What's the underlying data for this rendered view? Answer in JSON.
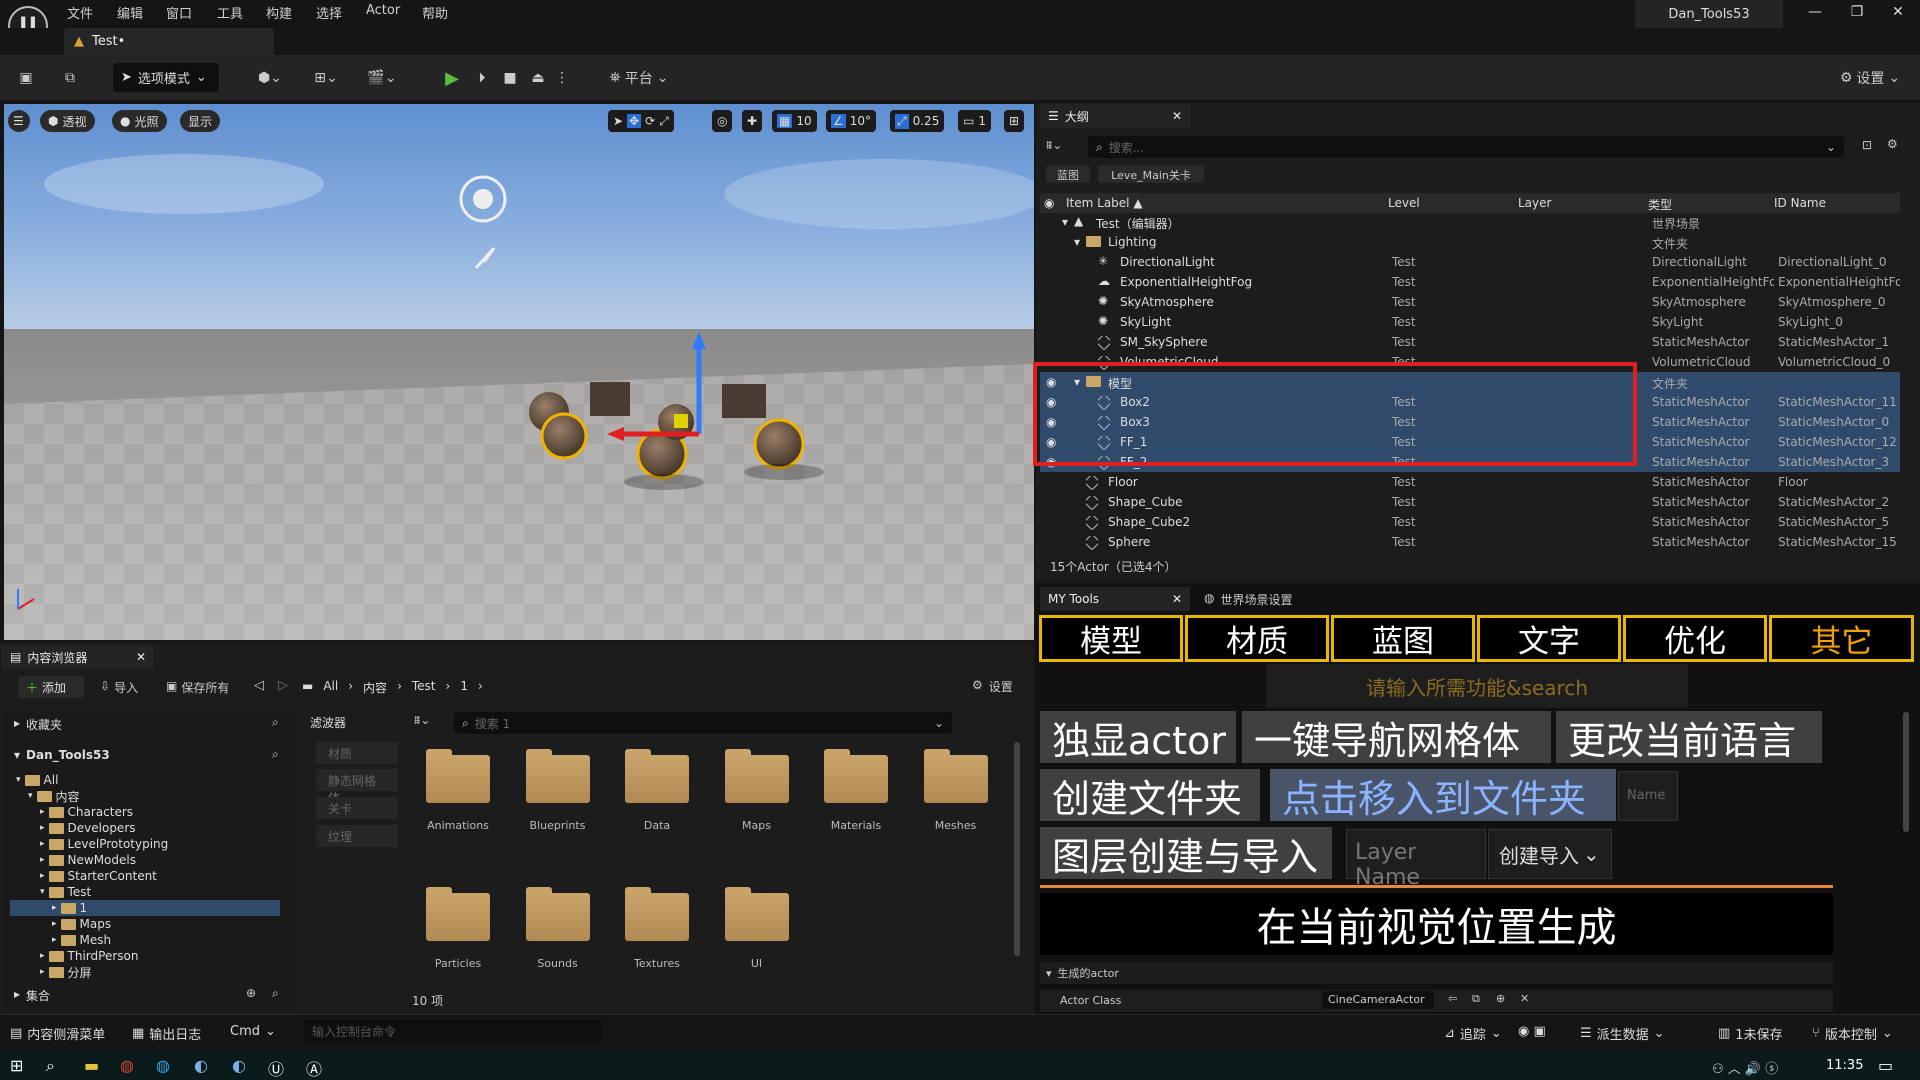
{
  "menu": [
    "文件",
    "编辑",
    "窗口",
    "工具",
    "构建",
    "选择",
    "Actor",
    "帮助"
  ],
  "project_name": "Dan_Tools53",
  "level_tab": "Test•",
  "toolbar": {
    "mode": "选项模式",
    "platform": "平台",
    "settings": "设置"
  },
  "viewport": {
    "perspective": "透视",
    "lighting": "光照",
    "show": "显示",
    "grid_snap": "10",
    "rot_snap": "10°",
    "scale_snap": "0.25",
    "camera_speed": "1"
  },
  "outliner": {
    "tab": "大纲",
    "search_placeholder": "搜索...",
    "chips": [
      "蓝图",
      "Leve_Main关卡"
    ],
    "columns": [
      "Item Label ▲",
      "Level",
      "Layer",
      "类型",
      "ID Name"
    ],
    "rows": [
      {
        "indent": 0,
        "kind": "world",
        "label": "Test（编辑器）",
        "level": "",
        "type": "世界场景",
        "id": "",
        "sel": false
      },
      {
        "indent": 1,
        "kind": "folder",
        "label": "Lighting",
        "level": "",
        "type": "文件夹",
        "id": "",
        "sel": false
      },
      {
        "indent": 2,
        "kind": "light",
        "label": "DirectionalLight",
        "level": "Test",
        "type": "DirectionalLight",
        "id": "DirectionalLight_0",
        "sel": false
      },
      {
        "indent": 2,
        "kind": "fog",
        "label": "ExponentialHeightFog",
        "level": "Test",
        "type": "ExponentialHeightFog",
        "id": "ExponentialHeightFog",
        "sel": false
      },
      {
        "indent": 2,
        "kind": "sky",
        "label": "SkyAtmosphere",
        "level": "Test",
        "type": "SkyAtmosphere",
        "id": "SkyAtmosphere_0",
        "sel": false
      },
      {
        "indent": 2,
        "kind": "sky",
        "label": "SkyLight",
        "level": "Test",
        "type": "SkyLight",
        "id": "SkyLight_0",
        "sel": false
      },
      {
        "indent": 2,
        "kind": "mesh",
        "label": "SM_SkySphere",
        "level": "Test",
        "type": "StaticMeshActor",
        "id": "StaticMeshActor_1",
        "sel": false
      },
      {
        "indent": 2,
        "kind": "mesh",
        "label": "VolumetricCloud",
        "level": "Test",
        "type": "VolumetricCloud",
        "id": "VolumetricCloud_0",
        "sel": false
      },
      {
        "indent": 1,
        "kind": "folder",
        "label": "模型",
        "level": "",
        "type": "文件夹",
        "id": "",
        "sel": true
      },
      {
        "indent": 2,
        "kind": "mesh",
        "label": "Box2",
        "level": "Test",
        "type": "StaticMeshActor",
        "id": "StaticMeshActor_11",
        "sel": true
      },
      {
        "indent": 2,
        "kind": "mesh",
        "label": "Box3",
        "level": "Test",
        "type": "StaticMeshActor",
        "id": "StaticMeshActor_0",
        "sel": true
      },
      {
        "indent": 2,
        "kind": "mesh",
        "label": "FF_1",
        "level": "Test",
        "type": "StaticMeshActor",
        "id": "StaticMeshActor_12",
        "sel": true
      },
      {
        "indent": 2,
        "kind": "mesh",
        "label": "FF_2",
        "level": "Test",
        "type": "StaticMeshActor",
        "id": "StaticMeshActor_3",
        "sel": true
      },
      {
        "indent": 1,
        "kind": "mesh",
        "label": "Floor",
        "level": "Test",
        "type": "StaticMeshActor",
        "id": "Floor",
        "sel": false
      },
      {
        "indent": 1,
        "kind": "mesh",
        "label": "Shape_Cube",
        "level": "Test",
        "type": "StaticMeshActor",
        "id": "StaticMeshActor_2",
        "sel": false
      },
      {
        "indent": 1,
        "kind": "mesh",
        "label": "Shape_Cube2",
        "level": "Test",
        "type": "StaticMeshActor",
        "id": "StaticMeshActor_5",
        "sel": false
      },
      {
        "indent": 1,
        "kind": "mesh",
        "label": "Sphere",
        "level": "Test",
        "type": "StaticMeshActor",
        "id": "StaticMeshActor_15",
        "sel": false
      }
    ],
    "status": "15个Actor（已选4个）"
  },
  "mytools": {
    "tab": "MY Tools",
    "tab2": "世界场景设置",
    "categories": [
      "模型",
      "材质",
      "蓝图",
      "文字",
      "优化",
      "其它"
    ],
    "search_hint": "请输入所需功能&search",
    "btn_isolate": "独显actor",
    "btn_navmesh": "一键导航网格体",
    "btn_language": "更改当前语言",
    "btn_create_folder": "创建文件夹",
    "btn_move_folder": "点击移入到文件夹",
    "name_placeholder": "Name",
    "btn_layer": "图层创建与导入",
    "layer_placeholder": "Layer Name",
    "create_import": "创建导入",
    "btn_spawn": "在当前视觉位置生成",
    "section_label": "生成的actor",
    "actor_class_label": "Actor Class",
    "actor_class_value": "CineCameraActor"
  },
  "content_browser": {
    "tab": "内容浏览器",
    "add": "添加",
    "import": "导入",
    "save_all": "保存所有",
    "settings": "设置",
    "breadcrumb": [
      "All",
      "内容",
      "Test",
      "1"
    ],
    "favorites": "收藏夹",
    "project": "Dan_Tools53",
    "tree": [
      {
        "indent": 0,
        "label": "All",
        "sel": false
      },
      {
        "indent": 1,
        "label": "内容",
        "sel": false
      },
      {
        "indent": 2,
        "label": "Characters",
        "sel": false
      },
      {
        "indent": 2,
        "label": "Developers",
        "sel": false
      },
      {
        "indent": 2,
        "label": "LevelPrototyping",
        "sel": false
      },
      {
        "indent": 2,
        "label": "NewModels",
        "sel": false
      },
      {
        "indent": 2,
        "label": "StarterContent",
        "sel": false
      },
      {
        "indent": 2,
        "label": "Test",
        "sel": false
      },
      {
        "indent": 3,
        "label": "1",
        "sel": true
      },
      {
        "indent": 3,
        "label": "Maps",
        "sel": false
      },
      {
        "indent": 3,
        "label": "Mesh",
        "sel": false
      },
      {
        "indent": 2,
        "label": "ThirdPerson",
        "sel": false
      },
      {
        "indent": 2,
        "label": "分屏",
        "sel": false
      }
    ],
    "collections": "集合",
    "filters_title": "滤波器",
    "filters": [
      "材质",
      "静态网格体",
      "关卡",
      "纹理"
    ],
    "search_placeholder": "搜索 1",
    "folders": [
      "Animations",
      "Blueprints",
      "Data",
      "Maps",
      "Materials",
      "Meshes",
      "Particles",
      "Sounds",
      "Textures",
      "UI"
    ],
    "item_count": "10 项"
  },
  "statusbar": {
    "content_drawer": "内容侧滑菜单",
    "output_log": "输出日志",
    "cmd": "Cmd",
    "console_placeholder": "输入控制台命令",
    "trace": "追踪",
    "derived_data": "派生数据",
    "unsaved": "1未保存",
    "source_control": "版本控制"
  },
  "taskbar": {
    "time": "11:35"
  }
}
